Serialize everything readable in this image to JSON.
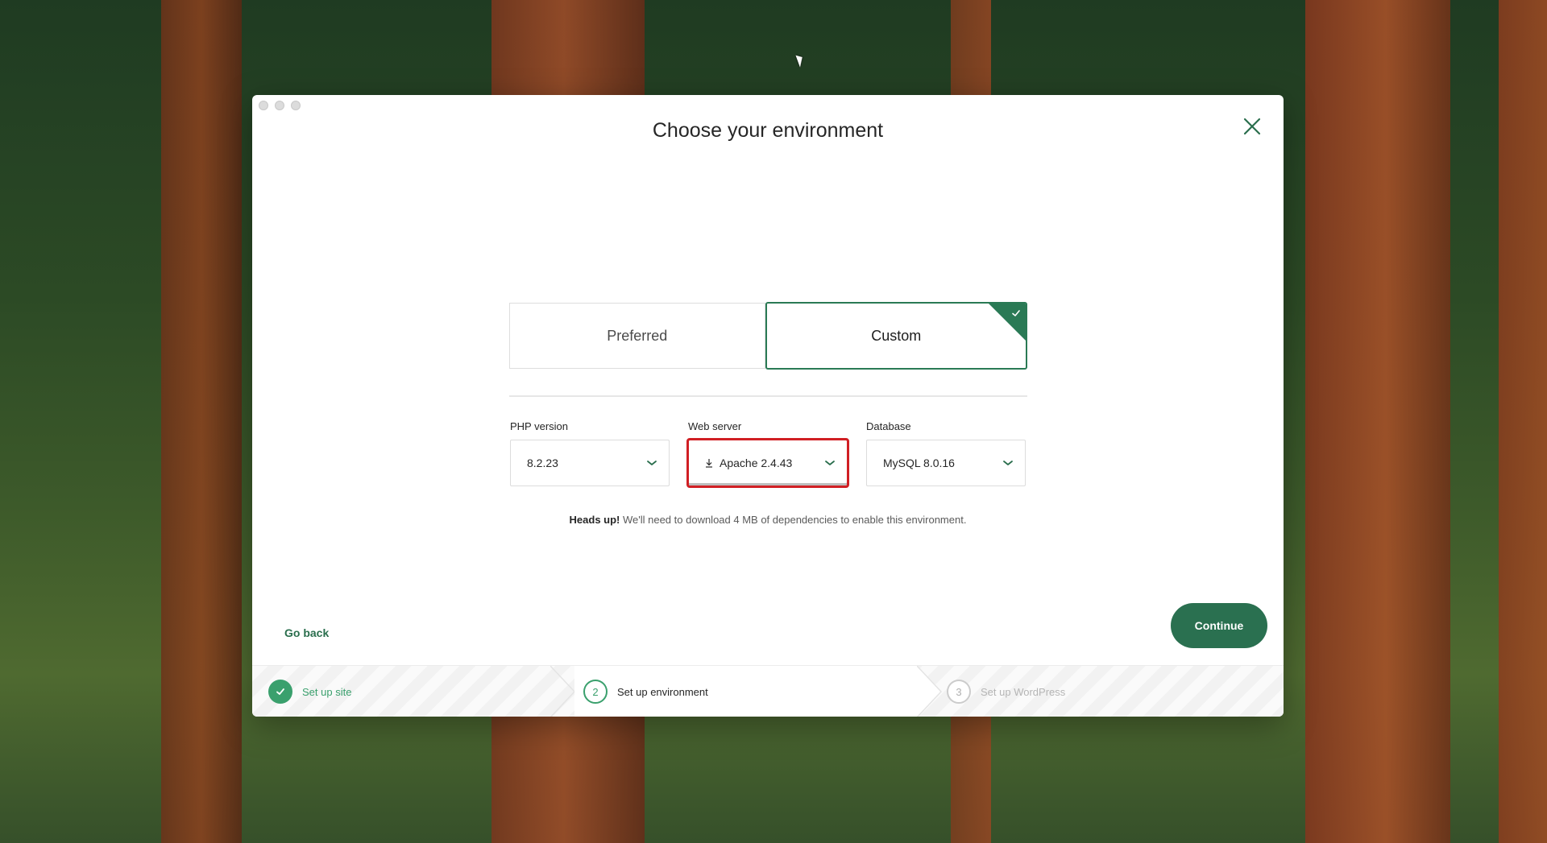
{
  "window": {
    "title": "Choose your environment"
  },
  "environment_toggle": {
    "options": [
      {
        "label": "Preferred",
        "selected": false
      },
      {
        "label": "Custom",
        "selected": true
      }
    ]
  },
  "fields": {
    "php": {
      "label": "PHP version",
      "value": "8.2.23"
    },
    "web_server": {
      "label": "Web server",
      "value": "Apache 2.4.43",
      "icon": "download-icon"
    },
    "database": {
      "label": "Database",
      "value": "MySQL 8.0.16"
    }
  },
  "notice": {
    "strong": "Heads up!",
    "text": " We'll need to download 4 MB of dependencies to enable this environment."
  },
  "actions": {
    "go_back": "Go back",
    "continue": "Continue"
  },
  "steps": [
    {
      "number": "1",
      "label": "Set up site",
      "state": "done"
    },
    {
      "number": "2",
      "label": "Set up environment",
      "state": "active"
    },
    {
      "number": "3",
      "label": "Set up WordPress",
      "state": "pending"
    }
  ],
  "colors": {
    "accent": "#2a7a55",
    "button": "#2a7050",
    "step_done": "#3aa06d",
    "highlight": "#d01f24"
  }
}
